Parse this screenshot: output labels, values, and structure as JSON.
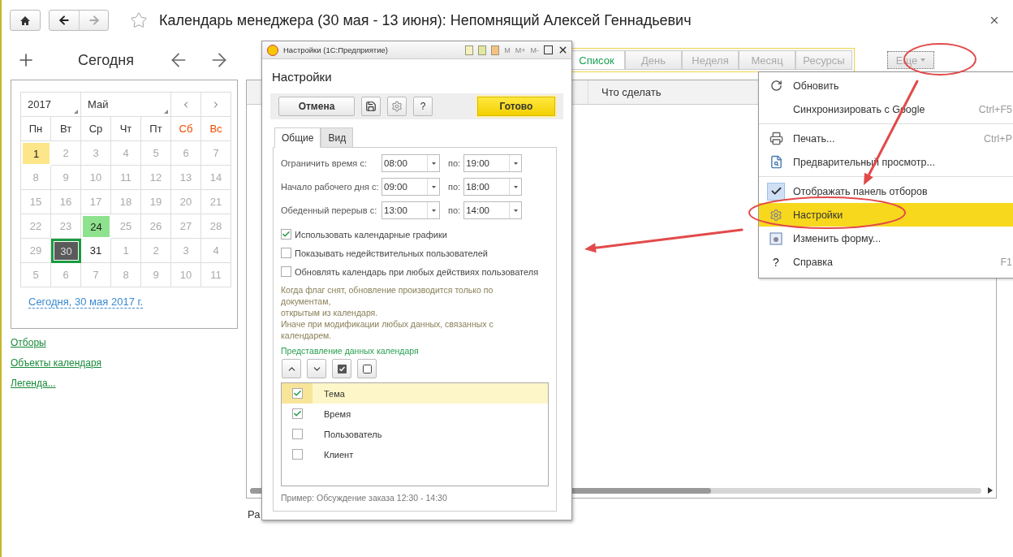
{
  "header": {
    "title": "Календарь менеджера (30 мая - 13 июня): Непомнящий Алексей Геннадьевич"
  },
  "toolbar": {
    "today_button": "Сегодня",
    "views": [
      {
        "label": "Список",
        "selected": true
      },
      {
        "label": "День",
        "selected": false
      },
      {
        "label": "Неделя",
        "selected": false
      },
      {
        "label": "Месяц",
        "selected": false
      },
      {
        "label": "Ресурсы",
        "selected": false
      }
    ],
    "more_button": "Еще"
  },
  "calendar": {
    "year": "2017",
    "month": "Май",
    "weekdays": [
      {
        "label": "Пн",
        "weekend": false
      },
      {
        "label": "Вт",
        "weekend": false
      },
      {
        "label": "Ср",
        "weekend": false
      },
      {
        "label": "Чт",
        "weekend": false
      },
      {
        "label": "Пт",
        "weekend": false
      },
      {
        "label": "Сб",
        "weekend": true
      },
      {
        "label": "Вс",
        "weekend": true
      }
    ],
    "weeks": [
      [
        {
          "day": "1",
          "kind": "holiday"
        },
        {
          "day": "2",
          "kind": "muted"
        },
        {
          "day": "3",
          "kind": "muted"
        },
        {
          "day": "4",
          "kind": "muted"
        },
        {
          "day": "5",
          "kind": "muted"
        },
        {
          "day": "6",
          "kind": "muted"
        },
        {
          "day": "7",
          "kind": "muted"
        }
      ],
      [
        {
          "day": "8",
          "kind": "muted"
        },
        {
          "day": "9",
          "kind": "muted"
        },
        {
          "day": "10",
          "kind": "muted"
        },
        {
          "day": "11",
          "kind": "muted"
        },
        {
          "day": "12",
          "kind": "muted"
        },
        {
          "day": "13",
          "kind": "muted"
        },
        {
          "day": "14",
          "kind": "muted"
        }
      ],
      [
        {
          "day": "15",
          "kind": "muted"
        },
        {
          "day": "16",
          "kind": "muted"
        },
        {
          "day": "17",
          "kind": "muted"
        },
        {
          "day": "18",
          "kind": "muted"
        },
        {
          "day": "19",
          "kind": "muted"
        },
        {
          "day": "20",
          "kind": "muted"
        },
        {
          "day": "21",
          "kind": "muted"
        }
      ],
      [
        {
          "day": "22",
          "kind": "muted"
        },
        {
          "day": "23",
          "kind": "muted"
        },
        {
          "day": "24",
          "kind": "event"
        },
        {
          "day": "25",
          "kind": "muted"
        },
        {
          "day": "26",
          "kind": "muted"
        },
        {
          "day": "27",
          "kind": "muted"
        },
        {
          "day": "28",
          "kind": "muted"
        }
      ],
      [
        {
          "day": "29",
          "kind": "muted"
        },
        {
          "day": "30",
          "kind": "today"
        },
        {
          "day": "31",
          "kind": "normal"
        },
        {
          "day": "1",
          "kind": "muted"
        },
        {
          "day": "2",
          "kind": "muted"
        },
        {
          "day": "3",
          "kind": "muted"
        },
        {
          "day": "4",
          "kind": "muted"
        }
      ],
      [
        {
          "day": "5",
          "kind": "muted"
        },
        {
          "day": "6",
          "kind": "muted"
        },
        {
          "day": "7",
          "kind": "muted"
        },
        {
          "day": "8",
          "kind": "muted"
        },
        {
          "day": "9",
          "kind": "muted"
        },
        {
          "day": "10",
          "kind": "muted"
        },
        {
          "day": "11",
          "kind": "muted"
        }
      ]
    ],
    "today_link": "Сегодня, 30 мая 2017 г."
  },
  "links": [
    "Отборы",
    "Объекты календаря",
    "Легенда..."
  ],
  "list": {
    "columns": [
      "Что сделать"
    ],
    "footer_text": "Ра"
  },
  "dialog": {
    "window_title": "Настройки (1С:Предприятие)",
    "memory_buttons": [
      "M",
      "M+",
      "M-"
    ],
    "heading": "Настройки",
    "cancel_button": "Отмена",
    "help_button": "?",
    "done_button": "Готово",
    "tabs": [
      {
        "label": "Общие",
        "selected": true
      },
      {
        "label": "Вид",
        "selected": false
      }
    ],
    "time_rows": [
      {
        "label": "Ограничить время с:",
        "from": "08:00",
        "to_label": "по:",
        "to": "19:00"
      },
      {
        "label": "Начало рабочего дня с:",
        "from": "09:00",
        "to_label": "по:",
        "to": "18:00"
      },
      {
        "label": "Обеденный перерыв с:",
        "from": "13:00",
        "to_label": "по:",
        "to": "14:00"
      }
    ],
    "options": [
      {
        "label": "Использовать календарные графики",
        "checked": true
      },
      {
        "label": "Показывать недействительных пользователей",
        "checked": false
      },
      {
        "label": "Обновлять календарь при любых действиях пользователя",
        "checked": false
      }
    ],
    "note_lines": [
      "Когда флаг снят, обновление производится только по",
      "документам,",
      "открытым из календаря.",
      "Иначе при модификации любых данных, связанных с",
      "календарем."
    ],
    "section_title": "Представление данных календаря",
    "fields": [
      {
        "label": "Тема",
        "checked": true,
        "selected": true
      },
      {
        "label": "Время",
        "checked": true,
        "selected": false
      },
      {
        "label": "Пользователь",
        "checked": false,
        "selected": false
      },
      {
        "label": "Клиент",
        "checked": false,
        "selected": false
      }
    ],
    "example": "Пример: Обсуждение заказа 12:30 - 14:30"
  },
  "menu": {
    "groups": [
      [
        {
          "kind": "refresh",
          "label": "Обновить",
          "selected": false
        },
        {
          "kind": "plain",
          "label": "Синхронизировать с Google",
          "shortcut": "Ctrl+F5",
          "selected": false
        }
      ],
      [
        {
          "kind": "print",
          "label": "Печать...",
          "shortcut": "Ctrl+P",
          "selected": false
        },
        {
          "kind": "preview",
          "label": "Предварительный просмотр...",
          "selected": false
        }
      ],
      [
        {
          "kind": "toggle",
          "label": "Отображать панель отборов",
          "checked": true,
          "selected": false
        },
        {
          "kind": "settings",
          "label": "Настройки",
          "selected": true
        },
        {
          "kind": "form",
          "label": "Изменить форму...",
          "selected": false
        },
        {
          "kind": "help",
          "glyph": "?",
          "label": "Справка",
          "shortcut": "F1",
          "selected": false
        }
      ]
    ]
  }
}
